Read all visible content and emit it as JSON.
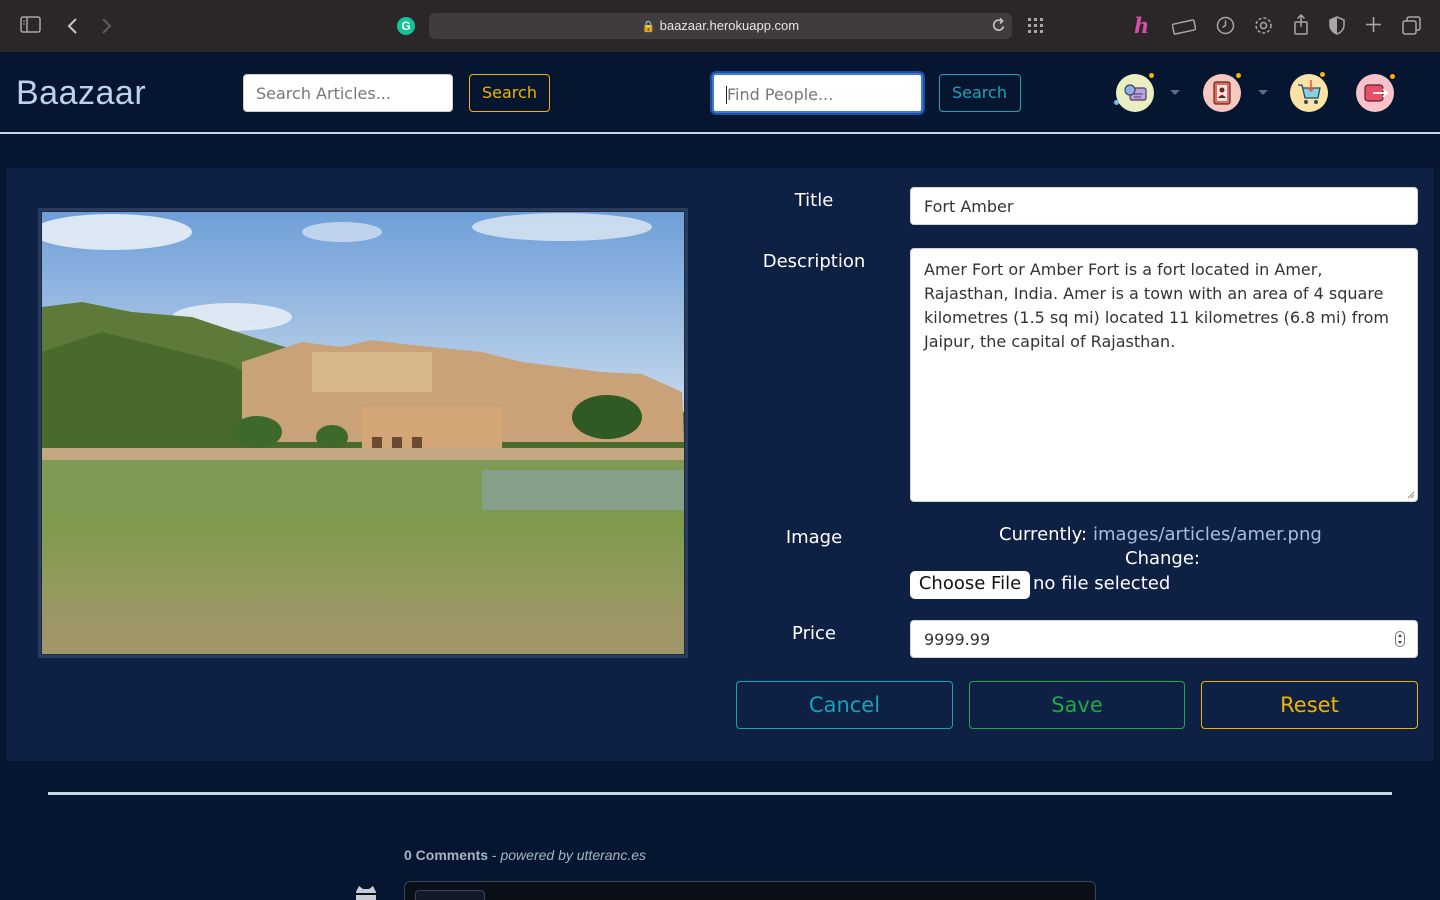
{
  "browser": {
    "url": "baazaar.herokuapp.com",
    "grammarly_letter": "G"
  },
  "navbar": {
    "brand": "Baazaar",
    "article_search": {
      "placeholder": "Search Articles...",
      "button": "Search"
    },
    "people_search": {
      "placeholder": "Find People...",
      "button": "Search"
    },
    "icons": [
      "settings-profile-icon",
      "address-book-icon",
      "shopping-cart-icon",
      "logout-icon"
    ]
  },
  "form": {
    "title_label": "Title",
    "title_value": "Fort Amber",
    "description_label": "Description",
    "description_value": "Amer Fort or Amber Fort is a fort located in Amer, Rajasthan, India. Amer is a town with an area of 4 square kilometres (1.5 sq mi) located 11 kilometres (6.8 mi) from Jaipur, the capital of Rajasthan.",
    "image_label": "Image",
    "currently_label": "Currently:",
    "current_image": "images/articles/amer.png",
    "change_label": "Change:",
    "choose_file": "Choose File",
    "no_file": "no file selected",
    "price_label": "Price",
    "price_value": "9999.99"
  },
  "actions": {
    "cancel": "Cancel",
    "save": "Save",
    "reset": "Reset"
  },
  "comments": {
    "count": "0 Comments",
    "powered": "powered by utteranc.es"
  }
}
